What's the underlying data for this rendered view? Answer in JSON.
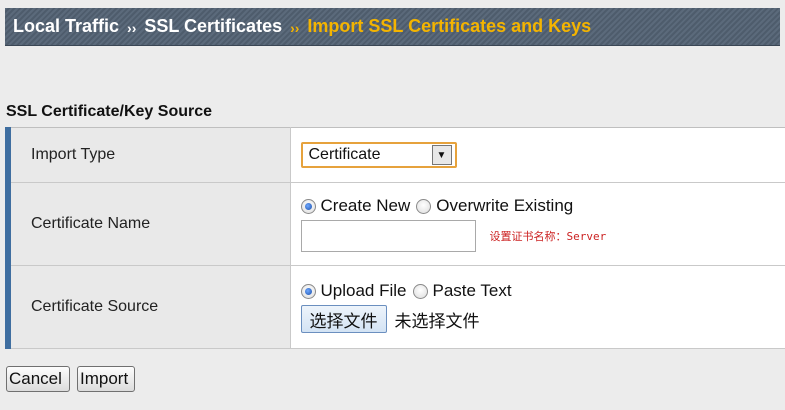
{
  "breadcrumb": {
    "items": [
      "Local Traffic",
      "SSL Certificates",
      "Import SSL Certificates and Keys"
    ],
    "separator": "››"
  },
  "section": {
    "title": "SSL Certificate/Key Source"
  },
  "form": {
    "import_type": {
      "label": "Import Type",
      "selected": "Certificate",
      "arrow": "▼"
    },
    "certificate_name": {
      "label": "Certificate Name",
      "options": [
        "Create New",
        "Overwrite Existing"
      ],
      "selected_option": "Create New",
      "value": "",
      "hint": "设置证书名称：Server"
    },
    "certificate_source": {
      "label": "Certificate Source",
      "options": [
        "Upload File",
        "Paste Text"
      ],
      "selected_option": "Upload File",
      "file_button": "选择文件",
      "file_status": "未选择文件"
    }
  },
  "actions": {
    "cancel": "Cancel",
    "import": "Import"
  },
  "colors": {
    "header_bg": "#5b6a7b",
    "current_crumb": "#f4b400",
    "row_accent": "#3f6ea0",
    "hint": "#cc2222"
  }
}
